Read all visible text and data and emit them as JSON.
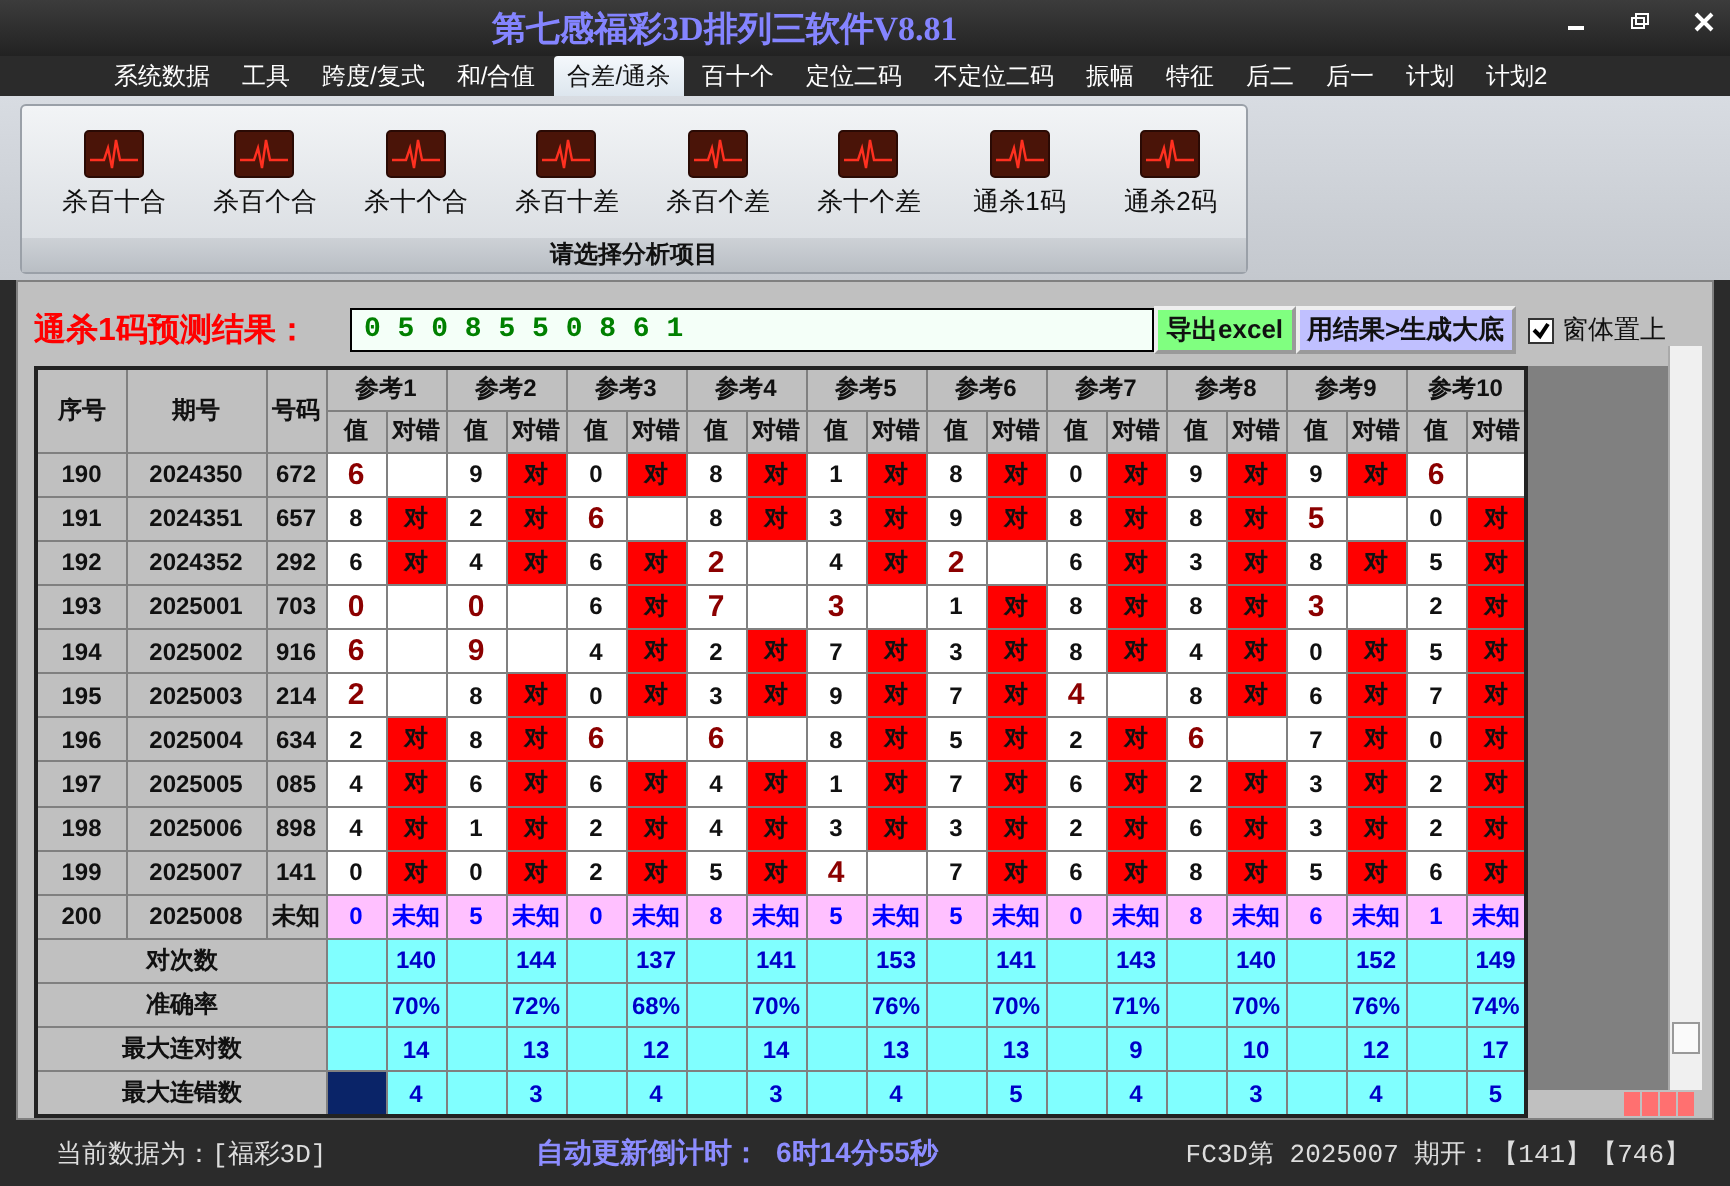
{
  "window": {
    "title": "第七感福彩3D排列三软件V8.81"
  },
  "menu": [
    {
      "label": "系统数据",
      "selected": false
    },
    {
      "label": "工具",
      "selected": false
    },
    {
      "label": "跨度/复式",
      "selected": false
    },
    {
      "label": "和/合值",
      "selected": false
    },
    {
      "label": "合差/通杀",
      "selected": true
    },
    {
      "label": "百十个",
      "selected": false
    },
    {
      "label": "定位二码",
      "selected": false
    },
    {
      "label": "不定位二码",
      "selected": false
    },
    {
      "label": "振幅",
      "selected": false
    },
    {
      "label": "特征",
      "selected": false
    },
    {
      "label": "后二",
      "selected": false
    },
    {
      "label": "后一",
      "selected": false
    },
    {
      "label": "计划",
      "selected": false
    },
    {
      "label": "计划2",
      "selected": false
    }
  ],
  "ribbon": {
    "items": [
      {
        "label": "杀百十合"
      },
      {
        "label": "杀百个合"
      },
      {
        "label": "杀十个合"
      },
      {
        "label": "杀百十差"
      },
      {
        "label": "杀百个差"
      },
      {
        "label": "杀十个差"
      },
      {
        "label": "通杀1码"
      },
      {
        "label": "通杀2码"
      }
    ],
    "group_label": "请选择分析项目"
  },
  "prediction": {
    "label": "通杀1码预测结果：",
    "value": "0 5 0 8 5 5 0 8 6 1"
  },
  "buttons": [
    {
      "label": "导出excel",
      "kind": "export"
    },
    {
      "label": "用结果>生成大底",
      "kind": "generate"
    }
  ],
  "pin_window": {
    "label": "窗体置上",
    "checked": true
  },
  "table": {
    "columns": [
      "序号",
      "期号",
      "号码"
    ],
    "ref_groups": [
      {
        "label": "参考1",
        "sub_columns": [
          "值",
          "对错"
        ]
      },
      {
        "label": "参考2",
        "sub_columns": [
          "值",
          "对错"
        ]
      },
      {
        "label": "参考3",
        "sub_columns": [
          "值",
          "对错"
        ]
      },
      {
        "label": "参考4",
        "sub_columns": [
          "值",
          "对错"
        ]
      },
      {
        "label": "参考5",
        "sub_columns": [
          "值",
          "对错"
        ]
      },
      {
        "label": "参考6",
        "sub_columns": [
          "值",
          "对错"
        ]
      },
      {
        "label": "参考7",
        "sub_columns": [
          "值",
          "对错"
        ]
      },
      {
        "label": "参考8",
        "sub_columns": [
          "值",
          "对错"
        ]
      },
      {
        "label": "参考9",
        "sub_columns": [
          "值",
          "对错"
        ]
      },
      {
        "label": "参考10",
        "sub_columns": [
          "值",
          "对错"
        ]
      }
    ],
    "rows": [
      {
        "no": "190",
        "period": "2024350",
        "number": "672",
        "kind": "done",
        "refs": [
          {
            "value": "6",
            "hit": false
          },
          {
            "value": "9",
            "hit": true,
            "result": "对"
          },
          {
            "value": "0",
            "hit": true,
            "result": "对"
          },
          {
            "value": "8",
            "hit": true,
            "result": "对"
          },
          {
            "value": "1",
            "hit": true,
            "result": "对"
          },
          {
            "value": "8",
            "hit": true,
            "result": "对"
          },
          {
            "value": "0",
            "hit": true,
            "result": "对"
          },
          {
            "value": "9",
            "hit": true,
            "result": "对"
          },
          {
            "value": "9",
            "hit": true,
            "result": "对"
          },
          {
            "value": "6",
            "hit": false
          }
        ]
      },
      {
        "no": "191",
        "period": "2024351",
        "number": "657",
        "kind": "done",
        "refs": [
          {
            "value": "8",
            "hit": true,
            "result": "对"
          },
          {
            "value": "2",
            "hit": true,
            "result": "对"
          },
          {
            "value": "6",
            "hit": false
          },
          {
            "value": "8",
            "hit": true,
            "result": "对"
          },
          {
            "value": "3",
            "hit": true,
            "result": "对"
          },
          {
            "value": "9",
            "hit": true,
            "result": "对"
          },
          {
            "value": "8",
            "hit": true,
            "result": "对"
          },
          {
            "value": "8",
            "hit": true,
            "result": "对"
          },
          {
            "value": "5",
            "hit": false
          },
          {
            "value": "0",
            "hit": true,
            "result": "对"
          }
        ]
      },
      {
        "no": "192",
        "period": "2024352",
        "number": "292",
        "kind": "done",
        "refs": [
          {
            "value": "6",
            "hit": true,
            "result": "对"
          },
          {
            "value": "4",
            "hit": true,
            "result": "对"
          },
          {
            "value": "6",
            "hit": true,
            "result": "对"
          },
          {
            "value": "2",
            "hit": false
          },
          {
            "value": "4",
            "hit": true,
            "result": "对"
          },
          {
            "value": "2",
            "hit": false
          },
          {
            "value": "6",
            "hit": true,
            "result": "对"
          },
          {
            "value": "3",
            "hit": true,
            "result": "对"
          },
          {
            "value": "8",
            "hit": true,
            "result": "对"
          },
          {
            "value": "5",
            "hit": true,
            "result": "对"
          }
        ]
      },
      {
        "no": "193",
        "period": "2025001",
        "number": "703",
        "kind": "done",
        "refs": [
          {
            "value": "0",
            "hit": false
          },
          {
            "value": "0",
            "hit": false
          },
          {
            "value": "6",
            "hit": true,
            "result": "对"
          },
          {
            "value": "7",
            "hit": false
          },
          {
            "value": "3",
            "hit": false
          },
          {
            "value": "1",
            "hit": true,
            "result": "对"
          },
          {
            "value": "8",
            "hit": true,
            "result": "对"
          },
          {
            "value": "8",
            "hit": true,
            "result": "对"
          },
          {
            "value": "3",
            "hit": false
          },
          {
            "value": "2",
            "hit": true,
            "result": "对"
          }
        ]
      },
      {
        "no": "194",
        "period": "2025002",
        "number": "916",
        "kind": "done",
        "refs": [
          {
            "value": "6",
            "hit": false
          },
          {
            "value": "9",
            "hit": false
          },
          {
            "value": "4",
            "hit": true,
            "result": "对"
          },
          {
            "value": "2",
            "hit": true,
            "result": "对"
          },
          {
            "value": "7",
            "hit": true,
            "result": "对"
          },
          {
            "value": "3",
            "hit": true,
            "result": "对"
          },
          {
            "value": "8",
            "hit": true,
            "result": "对"
          },
          {
            "value": "4",
            "hit": true,
            "result": "对"
          },
          {
            "value": "0",
            "hit": true,
            "result": "对"
          },
          {
            "value": "5",
            "hit": true,
            "result": "对"
          }
        ]
      },
      {
        "no": "195",
        "period": "2025003",
        "number": "214",
        "kind": "done",
        "refs": [
          {
            "value": "2",
            "hit": false
          },
          {
            "value": "8",
            "hit": true,
            "result": "对"
          },
          {
            "value": "0",
            "hit": true,
            "result": "对"
          },
          {
            "value": "3",
            "hit": true,
            "result": "对"
          },
          {
            "value": "9",
            "hit": true,
            "result": "对"
          },
          {
            "value": "7",
            "hit": true,
            "result": "对"
          },
          {
            "value": "4",
            "hit": false
          },
          {
            "value": "8",
            "hit": true,
            "result": "对"
          },
          {
            "value": "6",
            "hit": true,
            "result": "对"
          },
          {
            "value": "7",
            "hit": true,
            "result": "对"
          }
        ]
      },
      {
        "no": "196",
        "period": "2025004",
        "number": "634",
        "kind": "done",
        "refs": [
          {
            "value": "2",
            "hit": true,
            "result": "对"
          },
          {
            "value": "8",
            "hit": true,
            "result": "对"
          },
          {
            "value": "6",
            "hit": false
          },
          {
            "value": "6",
            "hit": false
          },
          {
            "value": "8",
            "hit": true,
            "result": "对"
          },
          {
            "value": "5",
            "hit": true,
            "result": "对"
          },
          {
            "value": "2",
            "hit": true,
            "result": "对"
          },
          {
            "value": "6",
            "hit": false
          },
          {
            "value": "7",
            "hit": true,
            "result": "对"
          },
          {
            "value": "0",
            "hit": true,
            "result": "对"
          }
        ]
      },
      {
        "no": "197",
        "period": "2025005",
        "number": "085",
        "kind": "done",
        "refs": [
          {
            "value": "4",
            "hit": true,
            "result": "对"
          },
          {
            "value": "6",
            "hit": true,
            "result": "对"
          },
          {
            "value": "6",
            "hit": true,
            "result": "对"
          },
          {
            "value": "4",
            "hit": true,
            "result": "对"
          },
          {
            "value": "1",
            "hit": true,
            "result": "对"
          },
          {
            "value": "7",
            "hit": true,
            "result": "对"
          },
          {
            "value": "6",
            "hit": true,
            "result": "对"
          },
          {
            "value": "2",
            "hit": true,
            "result": "对"
          },
          {
            "value": "3",
            "hit": true,
            "result": "对"
          },
          {
            "value": "2",
            "hit": true,
            "result": "对"
          }
        ]
      },
      {
        "no": "198",
        "period": "2025006",
        "number": "898",
        "kind": "done",
        "refs": [
          {
            "value": "4",
            "hit": true,
            "result": "对"
          },
          {
            "value": "1",
            "hit": true,
            "result": "对"
          },
          {
            "value": "2",
            "hit": true,
            "result": "对"
          },
          {
            "value": "4",
            "hit": true,
            "result": "对"
          },
          {
            "value": "3",
            "hit": true,
            "result": "对"
          },
          {
            "value": "3",
            "hit": true,
            "result": "对"
          },
          {
            "value": "2",
            "hit": true,
            "result": "对"
          },
          {
            "value": "6",
            "hit": true,
            "result": "对"
          },
          {
            "value": "3",
            "hit": true,
            "result": "对"
          },
          {
            "value": "2",
            "hit": true,
            "result": "对"
          }
        ]
      },
      {
        "no": "199",
        "period": "2025007",
        "number": "141",
        "kind": "done",
        "refs": [
          {
            "value": "0",
            "hit": true,
            "result": "对"
          },
          {
            "value": "0",
            "hit": true,
            "result": "对"
          },
          {
            "value": "2",
            "hit": true,
            "result": "对"
          },
          {
            "value": "5",
            "hit": true,
            "result": "对"
          },
          {
            "value": "4",
            "hit": false
          },
          {
            "value": "7",
            "hit": true,
            "result": "对"
          },
          {
            "value": "6",
            "hit": true,
            "result": "对"
          },
          {
            "value": "8",
            "hit": true,
            "result": "对"
          },
          {
            "value": "5",
            "hit": true,
            "result": "对"
          },
          {
            "value": "6",
            "hit": true,
            "result": "对"
          }
        ]
      },
      {
        "no": "200",
        "period": "2025008",
        "number": "未知",
        "kind": "pending",
        "refs": [
          {
            "value": "0",
            "result": "未知"
          },
          {
            "value": "5",
            "result": "未知"
          },
          {
            "value": "0",
            "result": "未知"
          },
          {
            "value": "8",
            "result": "未知"
          },
          {
            "value": "5",
            "result": "未知"
          },
          {
            "value": "5",
            "result": "未知"
          },
          {
            "value": "0",
            "result": "未知"
          },
          {
            "value": "8",
            "result": "未知"
          },
          {
            "value": "6",
            "result": "未知"
          },
          {
            "value": "1",
            "result": "未知"
          }
        ]
      }
    ],
    "stats": [
      {
        "label": "对次数",
        "cursor": false,
        "values": [
          "140",
          "144",
          "137",
          "141",
          "153",
          "141",
          "143",
          "140",
          "152",
          "149"
        ]
      },
      {
        "label": "准确率",
        "cursor": false,
        "values": [
          "70%",
          "72%",
          "68%",
          "70%",
          "76%",
          "70%",
          "71%",
          "70%",
          "76%",
          "74%"
        ]
      },
      {
        "label": "最大连对数",
        "cursor": false,
        "values": [
          "14",
          "13",
          "12",
          "14",
          "13",
          "13",
          "9",
          "10",
          "12",
          "17"
        ]
      },
      {
        "label": "最大连错数",
        "cursor": true,
        "values": [
          "4",
          "3",
          "4",
          "3",
          "4",
          "5",
          "4",
          "3",
          "4",
          "5"
        ]
      }
    ]
  },
  "status_bar": {
    "data_source": "当前数据为：[福彩3D]",
    "countdown_label": "自动更新倒计时：",
    "countdown": "6时14分55秒",
    "draw_info": "FC3D第 2025007 期开：【141】【746】"
  }
}
